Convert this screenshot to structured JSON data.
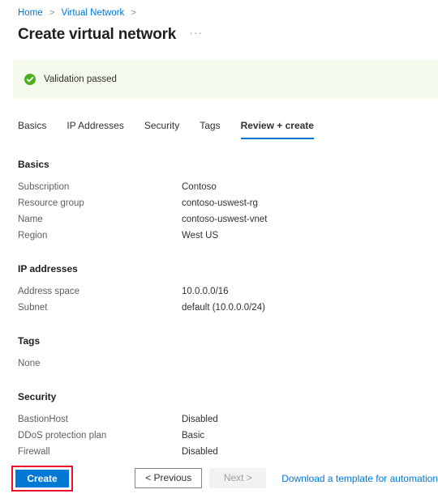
{
  "breadcrumb": {
    "items": [
      {
        "label": "Home"
      },
      {
        "label": "Virtual Network"
      }
    ],
    "separator": ">"
  },
  "header": {
    "title": "Create virtual network",
    "more_label": "···"
  },
  "banner": {
    "icon": "check-circle-icon",
    "text": "Validation passed"
  },
  "tabs": [
    {
      "label": "Basics"
    },
    {
      "label": "IP Addresses"
    },
    {
      "label": "Security"
    },
    {
      "label": "Tags"
    },
    {
      "label": "Review + create"
    }
  ],
  "sections": {
    "basics": {
      "title": "Basics",
      "rows": [
        {
          "key": "Subscription",
          "value": "Contoso"
        },
        {
          "key": "Resource group",
          "value": "contoso-uswest-rg"
        },
        {
          "key": "Name",
          "value": "contoso-uswest-vnet"
        },
        {
          "key": "Region",
          "value": "West US"
        }
      ]
    },
    "ip_addresses": {
      "title": "IP addresses",
      "rows": [
        {
          "key": "Address space",
          "value": "10.0.0.0/16"
        },
        {
          "key": "Subnet",
          "value": "default (10.0.0.0/24)"
        }
      ]
    },
    "tags": {
      "title": "Tags",
      "empty_text": "None"
    },
    "security": {
      "title": "Security",
      "rows": [
        {
          "key": "BastionHost",
          "value": "Disabled"
        },
        {
          "key": "DDoS protection plan",
          "value": "Basic"
        },
        {
          "key": "Firewall",
          "value": "Disabled"
        }
      ]
    }
  },
  "footer": {
    "create_label": "Create",
    "previous_label": "< Previous",
    "next_label": "Next >",
    "template_link_label": "Download a template for automation"
  },
  "colors": {
    "accent": "#0078d4",
    "success": "#4eaf1e",
    "banner_bg": "#f4faec",
    "highlight": "#e8112d",
    "label": "#605e5c",
    "value": "#323130"
  }
}
